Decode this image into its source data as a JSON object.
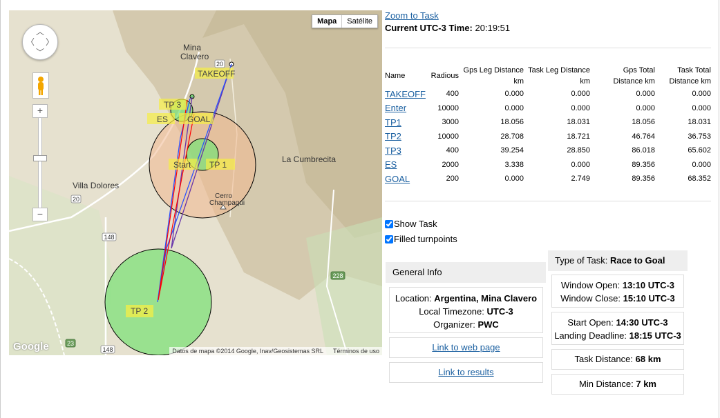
{
  "map": {
    "type_buttons": [
      "Mapa",
      "Satélite"
    ],
    "active_type": "Mapa",
    "labels": {
      "town_top": [
        "Mina",
        "Clavero"
      ],
      "villa_dolores": "Villa Dolores",
      "la_cumbrecita": "La Cumbrecita",
      "cerro": [
        "Cerro",
        "Champaqui"
      ]
    },
    "road_shields": [
      "20",
      "20",
      "148",
      "148",
      "228",
      "23"
    ],
    "turnpoint_labels": [
      "TAKEOFF",
      "TP 3",
      "ES",
      "GOAL",
      "Start",
      "TP 1",
      "TP 2"
    ],
    "brand": "Google",
    "attribution": "Datos de mapa ©2014 Google, Inav/Geosistemas SRL",
    "terms": "Términos de uso",
    "colors": {
      "cylinder_green": "#7fe07a",
      "cylinder_orange": "#f0b890",
      "label_yellow": "#f5ee44",
      "route_red": "#ff0000",
      "route_blue": "#2a52ff",
      "route_purple": "#6633aa"
    }
  },
  "panel": {
    "zoom_link": "Zoom to Task",
    "current_time_label": "Current UTC-3 Time:",
    "current_time_value": "20:19:51",
    "columns": [
      "Name",
      "Radious",
      "Gps Leg Distance km",
      "Task Leg Distance km",
      "Gps Total Distance km",
      "Task Total Distance km"
    ],
    "rows": [
      {
        "name": "TAKEOFF",
        "radius": "400",
        "gps_leg": "0.000",
        "task_leg": "0.000",
        "gps_total": "0.000",
        "task_total": "0.000"
      },
      {
        "name": "Enter",
        "radius": "10000",
        "gps_leg": "0.000",
        "task_leg": "0.000",
        "gps_total": "0.000",
        "task_total": "0.000"
      },
      {
        "name": "TP1",
        "radius": "3000",
        "gps_leg": "18.056",
        "task_leg": "18.031",
        "gps_total": "18.056",
        "task_total": "18.031"
      },
      {
        "name": "TP2",
        "radius": "10000",
        "gps_leg": "28.708",
        "task_leg": "18.721",
        "gps_total": "46.764",
        "task_total": "36.753"
      },
      {
        "name": "TP3",
        "radius": "400",
        "gps_leg": "39.254",
        "task_leg": "28.850",
        "gps_total": "86.018",
        "task_total": "65.602"
      },
      {
        "name": "ES",
        "radius": "2000",
        "gps_leg": "3.338",
        "task_leg": "0.000",
        "gps_total": "89.356",
        "task_total": "0.000"
      },
      {
        "name": "GOAL",
        "radius": "200",
        "gps_leg": "0.000",
        "task_leg": "2.749",
        "gps_total": "89.356",
        "task_total": "68.352"
      }
    ],
    "show_task": {
      "label": "Show Task",
      "checked": true
    },
    "filled_turnpoints": {
      "label": "Filled turnpoints",
      "checked": true
    },
    "general_info_title": "General Info",
    "location_label": "Location:",
    "location_value": "Argentina, Mina Clavero",
    "timezone_label": "Local Timezone:",
    "timezone_value": "UTC-3",
    "organizer_label": "Organizer:",
    "organizer_value": "PWC",
    "web_link": "Link to web page",
    "results_link": "Link to results",
    "task_type_label": "Type of Task:",
    "task_type_value": "Race to Goal",
    "window_open_label": "Window Open:",
    "window_open_value": "13:10 UTC-3",
    "window_close_label": "Window Close:",
    "window_close_value": "15:10 UTC-3",
    "start_open_label": "Start Open:",
    "start_open_value": "14:30 UTC-3",
    "landing_label": "Landing Deadline:",
    "landing_value": "18:15 UTC-3",
    "task_distance_label": "Task Distance:",
    "task_distance_value": "68 km",
    "min_distance_label": "Min Distance:",
    "min_distance_value": "7 km"
  }
}
